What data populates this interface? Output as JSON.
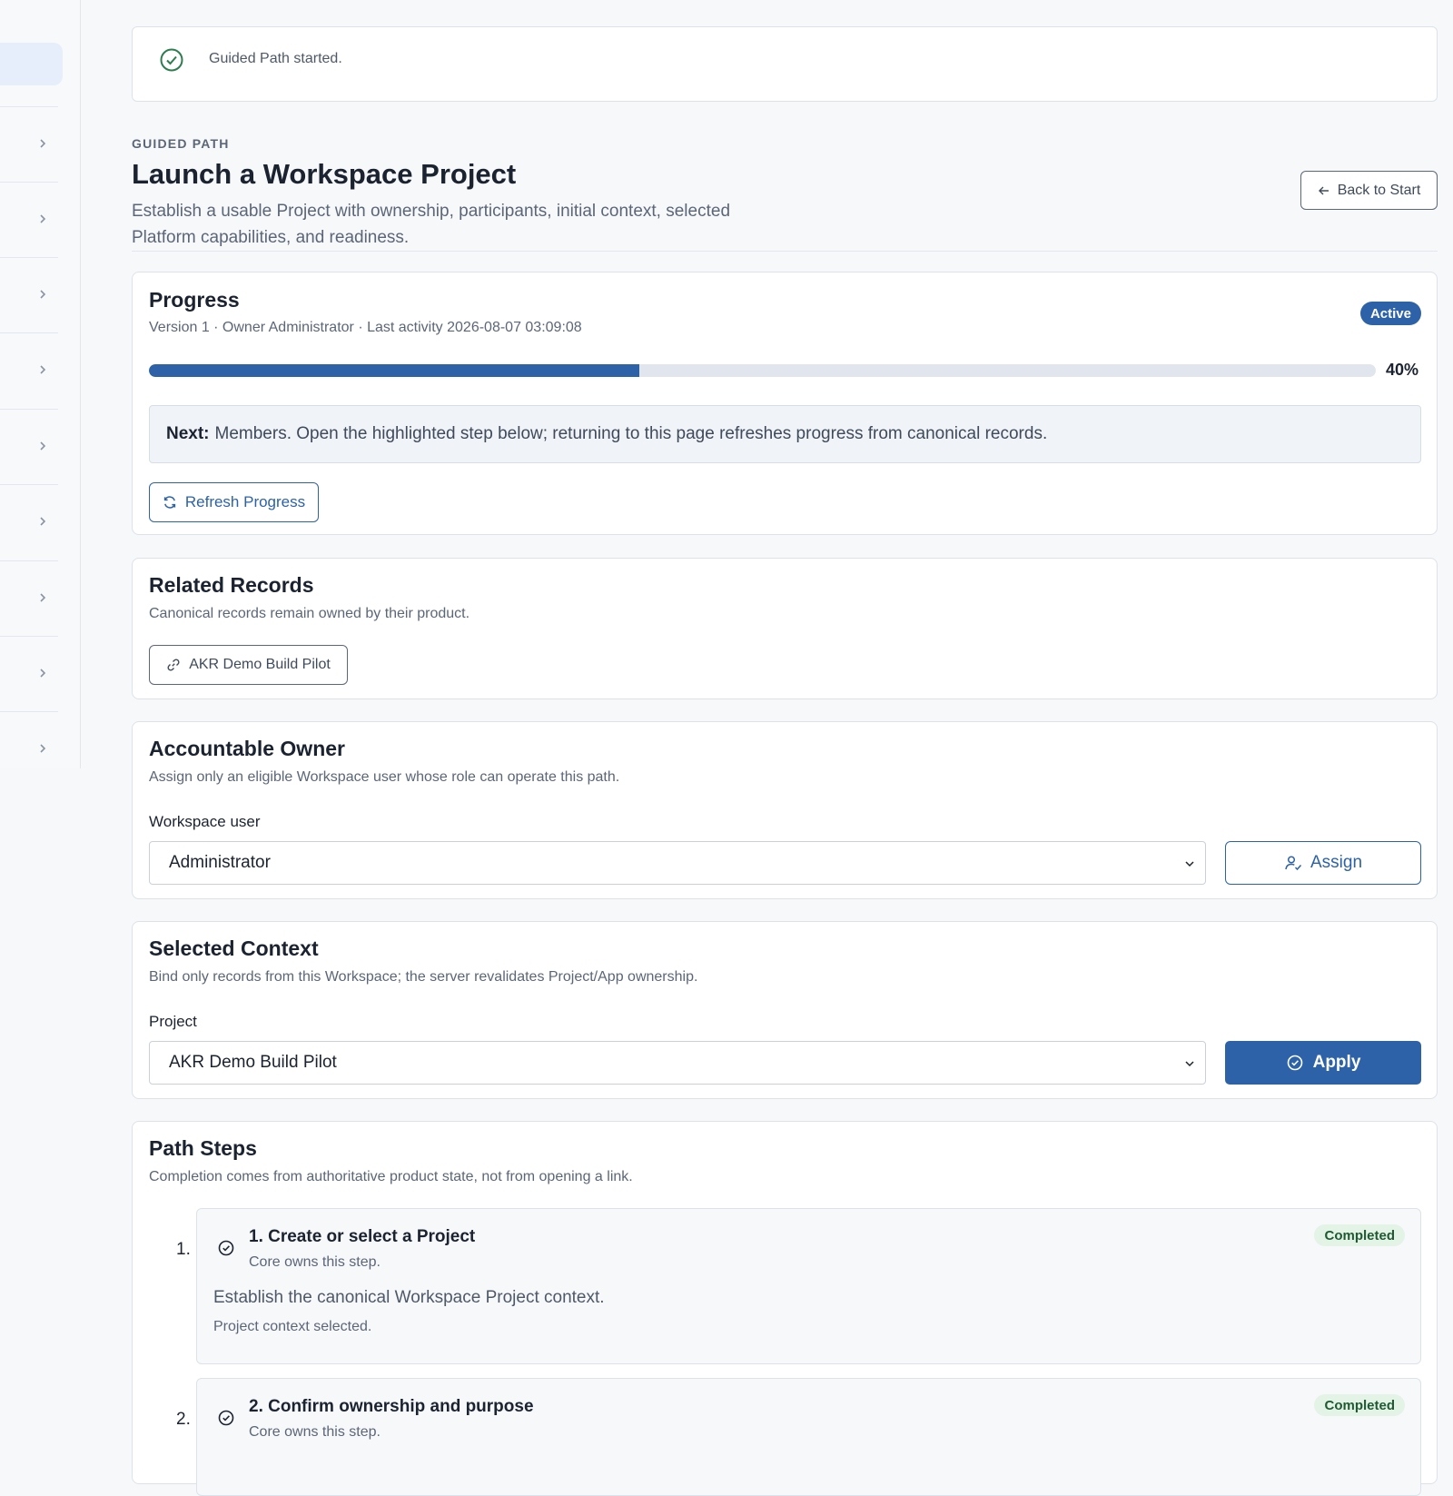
{
  "toast": {
    "message": "Guided Path started."
  },
  "header": {
    "eyebrow": "GUIDED PATH",
    "title": "Launch a Workspace Project",
    "description": "Establish a usable Project with ownership, participants, initial context, selected Platform capabilities, and readiness.",
    "back_label": "Back to Start"
  },
  "progress": {
    "title": "Progress",
    "meta": "Version 1 · Owner Administrator · Last activity 2026-08-07 03:09:08",
    "status": "Active",
    "percent": 40,
    "percent_label": "40%",
    "next_label": "Next:",
    "next_text": "Members. Open the highlighted step below; returning to this page refreshes progress from canonical records.",
    "refresh_label": "Refresh Progress"
  },
  "related": {
    "title": "Related Records",
    "subtitle": "Canonical records remain owned by their product.",
    "record_label": "AKR Demo Build Pilot"
  },
  "owner": {
    "title": "Accountable Owner",
    "subtitle": "Assign only an eligible Workspace user whose role can operate this path.",
    "field_label": "Workspace user",
    "selected": "Administrator",
    "assign_label": "Assign"
  },
  "context": {
    "title": "Selected Context",
    "subtitle": "Bind only records from this Workspace; the server revalidates Project/App ownership.",
    "field_label": "Project",
    "selected": "AKR Demo Build Pilot",
    "apply_label": "Apply"
  },
  "steps": {
    "title": "Path Steps",
    "subtitle": "Completion comes from authoritative product state, not from opening a link.",
    "items": [
      {
        "number": "1.",
        "title": "1. Create or select a Project",
        "owner": "Core owns this step.",
        "status": "Completed",
        "description": "Establish the canonical Workspace Project context.",
        "note": "Project context selected."
      },
      {
        "number": "2.",
        "title": "2. Confirm ownership and purpose",
        "owner": "Core owns this step.",
        "status": "Completed"
      }
    ]
  },
  "colors": {
    "accent": "#2d62a8",
    "success_bg": "#e3f3e6",
    "success_text": "#1f5a33",
    "toast_icon": "#2e7d4f"
  },
  "icons": {
    "toast": "check-circle-icon",
    "back": "arrow-left-icon",
    "refresh": "refresh-icon",
    "link": "link-icon",
    "assign": "user-check-icon",
    "apply": "check-circle-icon",
    "sidebar_chevron": "chevron-right-icon",
    "select": "chevron-down-icon"
  }
}
